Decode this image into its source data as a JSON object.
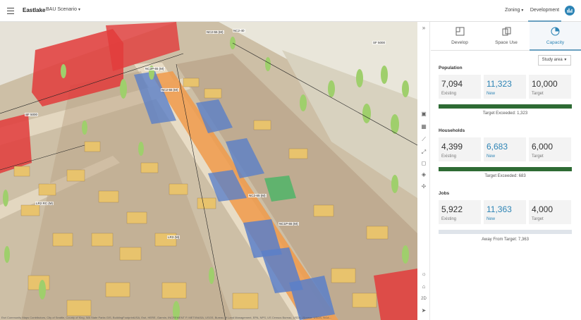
{
  "header": {
    "app_title": "Eastlake",
    "scenario": "BAU Scenario",
    "zoning": "Zoning",
    "dev_tab": "Development"
  },
  "toolstrip": {
    "expand": "»",
    "mode_2d": "2D"
  },
  "panel": {
    "tabs": [
      {
        "label": "Develop",
        "icon": "develop-icon"
      },
      {
        "label": "Space Use",
        "icon": "space-use-icon"
      },
      {
        "label": "Capacity",
        "icon": "capacity-icon"
      }
    ],
    "active_tab": "Capacity",
    "study_area": "Study area",
    "sections": {
      "population": {
        "title": "Population",
        "existing": "7,094",
        "existing_label": "Existing",
        "new": "11,323",
        "new_label": "New",
        "target": "10,000",
        "target_label": "Target",
        "progress": 1.0,
        "caption": "Target Exceeded: 1,323"
      },
      "households": {
        "title": "Households",
        "existing": "4,399",
        "existing_label": "Existing",
        "new": "6,683",
        "new_label": "New",
        "target": "6,000",
        "target_label": "Target",
        "progress": 1.0,
        "caption": "Target Exceeded: 683"
      },
      "jobs": {
        "title": "Jobs",
        "existing": "5,922",
        "existing_label": "Existing",
        "new": "11,363",
        "new_label": "New",
        "target": "4,000",
        "target_label": "Target",
        "progress": 0.0,
        "caption": "Away From Target: 7,363"
      }
    },
    "colors": {
      "accent": "#2d84b5",
      "progress": "#2e6b34",
      "track": "#dfe4ea"
    }
  },
  "map": {
    "zone_labels": [
      "SF 5000",
      "NC2-55 (M)",
      "NC2-40",
      "NC2P-55 (M)",
      "NC2-55 (M)",
      "SF 5000",
      "NC2-65 (M)",
      "LR2 RC (M)",
      "NC1P-65 (M)",
      "LR3 (M)"
    ],
    "attribution": "Esri Community Maps Contributors, City of Seattle, County of King, WA State Parks GIS, BuildingFootprintUSA, Esri, HERE, Garmin, INCREMENT P, METI/NASA, USGS, Bureau of Land Management, EPA, NPS, US Census Bureau, USDA | Source: USGS, NGA..."
  }
}
